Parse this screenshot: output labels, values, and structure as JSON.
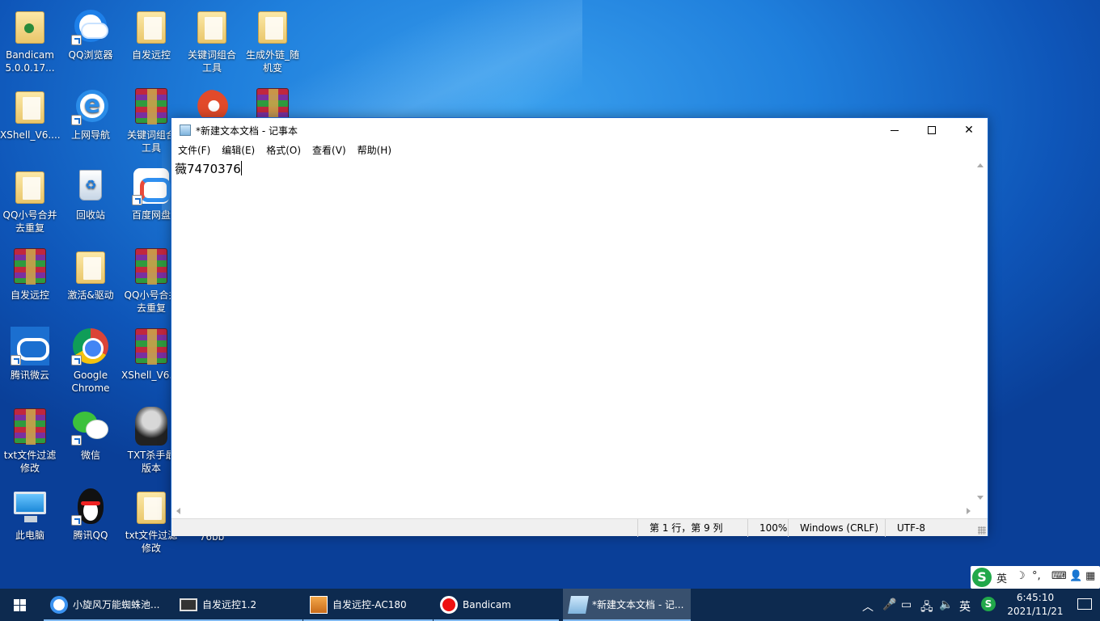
{
  "desktop": {
    "icons": [
      {
        "label": "Bandicam\n5.0.0.17..."
      },
      {
        "label": "QQ浏览器"
      },
      {
        "label": "自发远控"
      },
      {
        "label": "关键词组合\n工具"
      },
      {
        "label": "生成外链_随\n机变"
      },
      {
        "label": "XShell_V6...."
      },
      {
        "label": "上网导航"
      },
      {
        "label": "关键词组合\n工具"
      },
      {
        "label": "QQ小号合并\n去重复"
      },
      {
        "label": "回收站"
      },
      {
        "label": "百度网盘"
      },
      {
        "label": "自发远控"
      },
      {
        "label": "激活&驱动"
      },
      {
        "label": "QQ小号合并\n去重复"
      },
      {
        "label": "腾讯微云"
      },
      {
        "label": "Google\nChrome"
      },
      {
        "label": "XShell_V6...."
      },
      {
        "label": "txt文件过滤\n修改"
      },
      {
        "label": "微信"
      },
      {
        "label": "TXT杀手最\n版本"
      },
      {
        "label": "此电脑"
      },
      {
        "label": "腾讯QQ"
      },
      {
        "label": "txt文件过滤\n修改"
      },
      {
        "label": "76bb"
      }
    ]
  },
  "notepad": {
    "title": "*新建文本文档 - 记事本",
    "menu": [
      "文件(F)",
      "编辑(E)",
      "格式(O)",
      "查看(V)",
      "帮助(H)"
    ],
    "content": "薇7470376",
    "status": {
      "position": "第 1 行，第 9 列",
      "zoom": "100%",
      "line_ending": "Windows (CRLF)",
      "encoding": "UTF-8"
    }
  },
  "ime": {
    "logo": "S",
    "lang": "英",
    "moon": "☽",
    "punct": "°,",
    "keyboard": "⌨",
    "user": "👤",
    "grid": "▦"
  },
  "taskbar": {
    "tasks": [
      {
        "label": "小旋风万能蜘蛛池..."
      },
      {
        "label": "自发远控1.2"
      },
      {
        "label": "自发远控-AC180"
      },
      {
        "label": "Bandicam"
      },
      {
        "label": "*新建文本文档 - 记..."
      }
    ],
    "tray": {
      "chevron": "︿",
      "lang": "英",
      "ime_logo": "S"
    },
    "clock": {
      "time": "6:45:10",
      "date": "2021/11/21"
    }
  }
}
